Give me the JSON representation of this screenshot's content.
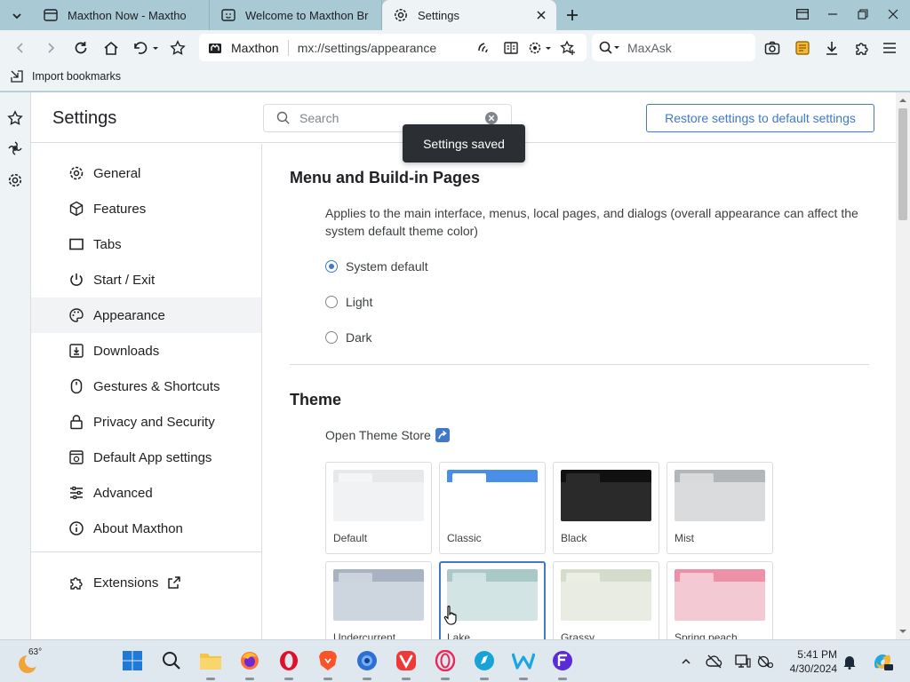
{
  "tabs": [
    {
      "title": "Maxthon Now - Maxtho",
      "active": false
    },
    {
      "title": "Welcome to Maxthon Br",
      "active": false
    },
    {
      "title": "Settings",
      "active": true
    }
  ],
  "toolbar": {
    "site_name": "Maxthon",
    "url": "mx://settings/appearance",
    "search_placeholder": "MaxAsk"
  },
  "bookmarks_bar": {
    "import_label": "Import bookmarks"
  },
  "settings": {
    "title": "Settings",
    "search_placeholder": "Search",
    "restore_button": "Restore settings to default settings",
    "toast": "Settings saved",
    "nav": [
      {
        "label": "General",
        "icon": "gear-icon"
      },
      {
        "label": "Features",
        "icon": "cube-icon"
      },
      {
        "label": "Tabs",
        "icon": "tabs-icon"
      },
      {
        "label": "Start / Exit",
        "icon": "power-icon"
      },
      {
        "label": "Appearance",
        "icon": "palette-icon",
        "selected": true
      },
      {
        "label": "Downloads",
        "icon": "download-icon"
      },
      {
        "label": "Gestures & Shortcuts",
        "icon": "mouse-icon"
      },
      {
        "label": "Privacy and Security",
        "icon": "lock-icon"
      },
      {
        "label": "Default App settings",
        "icon": "app-icon"
      },
      {
        "label": "Advanced",
        "icon": "sliders-icon"
      },
      {
        "label": "About Maxthon",
        "icon": "info-icon"
      }
    ],
    "extensions_label": "Extensions",
    "menu_section": {
      "title": "Menu and Build-in Pages",
      "description": "Applies to the main interface, menus, local pages, and dialogs (overall appearance can affect the system default theme color)",
      "options": [
        {
          "label": "System default",
          "checked": true
        },
        {
          "label": "Light",
          "checked": false
        },
        {
          "label": "Dark",
          "checked": false
        }
      ]
    },
    "theme_section": {
      "title": "Theme",
      "store_link": "Open Theme Store",
      "themes": [
        {
          "name": "Default",
          "bar": "#e6e8ea",
          "tab": "#f4f5f6",
          "body": "#f1f2f3"
        },
        {
          "name": "Classic",
          "bar": "#4a8fe7",
          "tab": "#ffffff",
          "body": "#ffffff"
        },
        {
          "name": "Black",
          "bar": "#111111",
          "tab": "#2a2a2a",
          "body": "#2a2a2a"
        },
        {
          "name": "Mist",
          "bar": "#b2b6b9",
          "tab": "#d7d9db",
          "body": "#d9dbdd"
        },
        {
          "name": "Undercurrent",
          "bar": "#a7b3c2",
          "tab": "#cbd3dd",
          "body": "#cdd5de"
        },
        {
          "name": "Lake",
          "bar": "#a9c9c8",
          "tab": "#d0e2e2",
          "body": "#d3e4e5",
          "selected": true
        },
        {
          "name": "Grassy",
          "bar": "#d6dccc",
          "tab": "#eaeee3",
          "body": "#e9ece2"
        },
        {
          "name": "Spring peach",
          "bar": "#ee90a6",
          "tab": "#f6c8d3",
          "body": "#f3c9d3"
        }
      ]
    }
  },
  "taskbar": {
    "weather_temp": "63°",
    "time": "5:41 PM",
    "date": "4/30/2024"
  },
  "colors": {
    "accent": "#3f79c7",
    "chrome": "#a9c9d4",
    "toolbar": "#eef3f5"
  }
}
